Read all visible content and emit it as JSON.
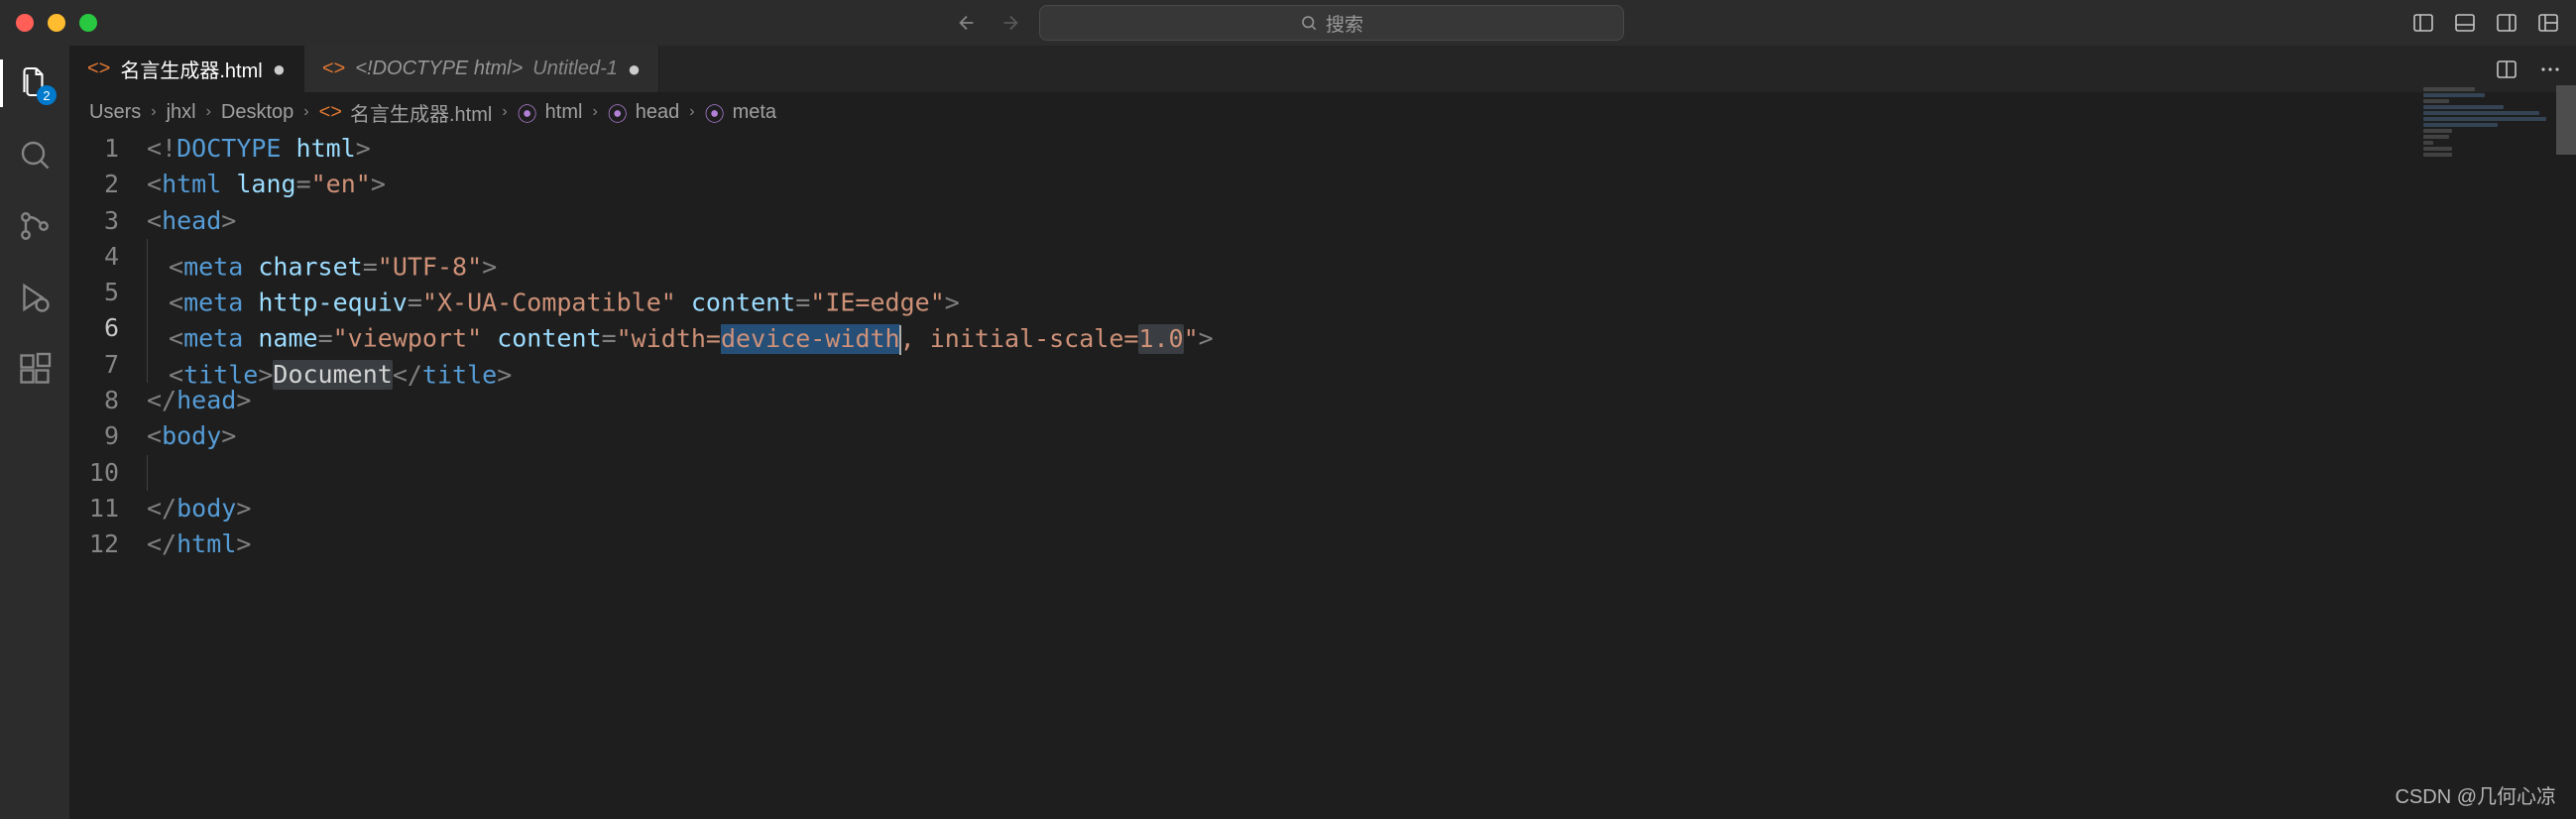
{
  "titlebar": {
    "search_placeholder": "搜索"
  },
  "activity": {
    "explorer_badge": "2"
  },
  "tabs": [
    {
      "label": "名言生成器.html",
      "dirty": true,
      "active": true
    },
    {
      "label": "<!DOCTYPE html>",
      "secondary": "Untitled-1",
      "dirty": true,
      "active": false
    }
  ],
  "breadcrumb": {
    "parts": [
      "Users",
      "jhxl",
      "Desktop",
      "名言生成器.html",
      "html",
      "head",
      "meta"
    ]
  },
  "editor": {
    "active_line": 6,
    "lines": [
      {
        "n": 1,
        "indent": 0,
        "html": "<span class='p-tag'>&lt;!</span><span class='p-doctype'>DOCTYPE</span> <span class='p-attr'>html</span><span class='p-tag'>&gt;</span>"
      },
      {
        "n": 2,
        "indent": 0,
        "html": "<span class='p-tag'>&lt;</span><span class='p-name'>html</span> <span class='p-attr'>lang</span><span class='p-tag'>=</span><span class='p-str'>\"en\"</span><span class='p-tag'>&gt;</span>"
      },
      {
        "n": 3,
        "indent": 0,
        "html": "<span class='p-tag'>&lt;</span><span class='p-name'>head</span><span class='p-tag'>&gt;</span>"
      },
      {
        "n": 4,
        "indent": 1,
        "html": "<span class='p-tag'>&lt;</span><span class='p-name'>meta</span> <span class='p-attr'>charset</span><span class='p-tag'>=</span><span class='p-str'>\"UTF-8\"</span><span class='p-tag'>&gt;</span>"
      },
      {
        "n": 5,
        "indent": 1,
        "html": "<span class='p-tag'>&lt;</span><span class='p-name'>meta</span> <span class='p-attr'>http-equiv</span><span class='p-tag'>=</span><span class='p-str'>\"X-UA-Compatible\"</span> <span class='p-attr'>content</span><span class='p-tag'>=</span><span class='p-str'>\"IE=edge\"</span><span class='p-tag'>&gt;</span>"
      },
      {
        "n": 6,
        "indent": 1,
        "html": "<span class='p-tag'>&lt;</span><span class='p-name'>meta</span> <span class='p-attr'>name</span><span class='p-tag'>=</span><span class='p-str'>\"viewport\"</span> <span class='p-attr'>content</span><span class='p-tag'>=</span><span class='p-str'>\"width=<span class='hl-sel'>device-width</span><span class='cursor'></span>, initial-scale=<span class='hl-word'>1.0</span>\"</span><span class='p-tag'>&gt;</span>"
      },
      {
        "n": 7,
        "indent": 1,
        "html": "<span class='p-tag'>&lt;</span><span class='p-name'>title</span><span class='p-tag'>&gt;</span><span class='hl-word'><span class='p-text'>Document</span></span><span class='p-tag'>&lt;/</span><span class='p-name'>title</span><span class='p-tag'>&gt;</span>"
      },
      {
        "n": 8,
        "indent": 0,
        "html": "<span class='p-tag'>&lt;/</span><span class='p-name'>head</span><span class='p-tag'>&gt;</span>"
      },
      {
        "n": 9,
        "indent": 0,
        "html": "<span class='p-tag'>&lt;</span><span class='p-name'>body</span><span class='p-tag'>&gt;</span>"
      },
      {
        "n": 10,
        "indent": 1,
        "html": ""
      },
      {
        "n": 11,
        "indent": 0,
        "html": "<span class='p-tag'>&lt;/</span><span class='p-name'>body</span><span class='p-tag'>&gt;</span>"
      },
      {
        "n": 12,
        "indent": 0,
        "html": "<span class='p-tag'>&lt;/</span><span class='p-name'>html</span><span class='p-tag'>&gt;</span>"
      }
    ]
  },
  "watermark": "CSDN @几何心凉"
}
